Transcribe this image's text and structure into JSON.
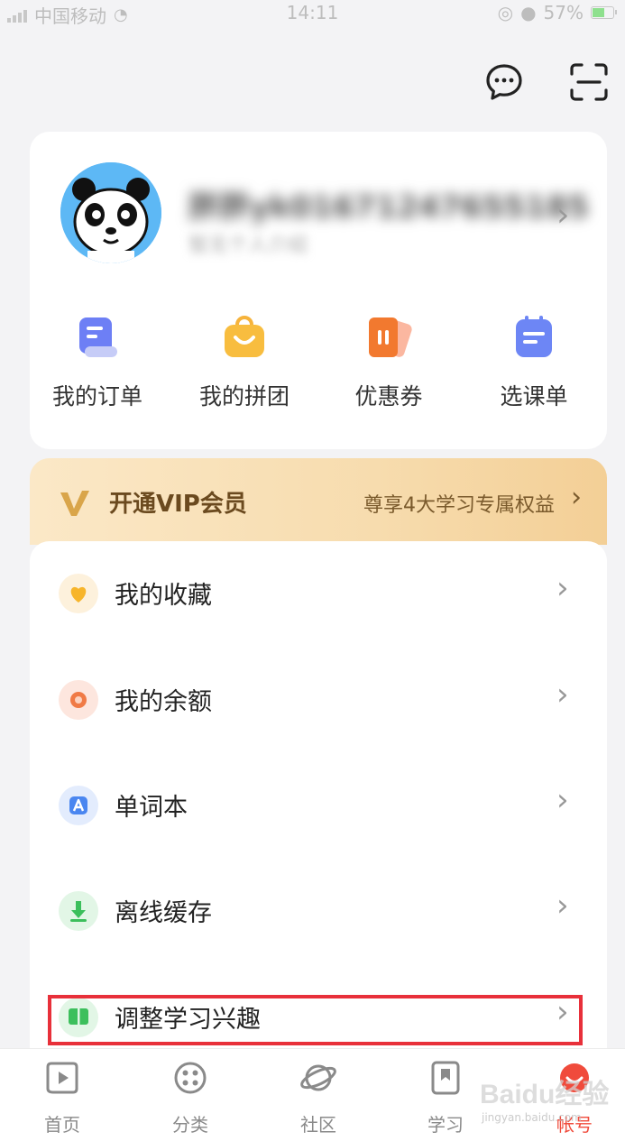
{
  "status_bar": {
    "carrier": "中国移动",
    "time": "14:11",
    "battery": "57%",
    "battery_level": 0.57
  },
  "header": {
    "message_icon": "chat-bubble-icon",
    "scan_icon": "scan-icon"
  },
  "profile": {
    "username": "胖胖yk01671247655185",
    "bio": "暂无个人介绍"
  },
  "quick_actions": [
    {
      "label": "我的订单",
      "icon": "order-icon",
      "color": "#6d7ff5"
    },
    {
      "label": "我的拼团",
      "icon": "group-buy-icon",
      "color": "#f6b33b"
    },
    {
      "label": "优惠券",
      "icon": "coupon-icon",
      "color": "#f2792f"
    },
    {
      "label": "选课单",
      "icon": "course-list-icon",
      "color": "#6d86f5"
    }
  ],
  "vip": {
    "title": "开通VIP会员",
    "subtitle": "尊享4大学习专属权益"
  },
  "menu": [
    {
      "label": "我的收藏",
      "icon": "heart-icon"
    },
    {
      "label": "我的余额",
      "icon": "balance-icon"
    },
    {
      "label": "单词本",
      "icon": "vocabulary-icon"
    },
    {
      "label": "离线缓存",
      "icon": "download-icon"
    },
    {
      "label": "调整学习兴趣",
      "icon": "book-icon"
    }
  ],
  "tabs": [
    {
      "label": "首页",
      "icon": "home-play-icon"
    },
    {
      "label": "分类",
      "icon": "category-icon"
    },
    {
      "label": "社区",
      "icon": "planet-icon"
    },
    {
      "label": "学习",
      "icon": "bookmark-icon"
    },
    {
      "label": "帐号",
      "icon": "account-icon",
      "active": true
    }
  ],
  "watermark": {
    "brand": "Baidu经验",
    "url": "jingyan.baidu.com"
  },
  "colors": {
    "accent": "#f04b3c",
    "highlight_box": "#e8303a",
    "vip_text": "#6b4a1f"
  }
}
